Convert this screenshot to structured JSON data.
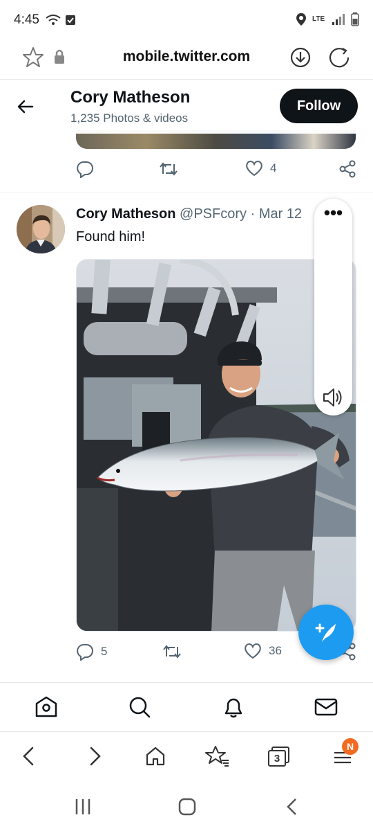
{
  "status_bar": {
    "time": "4:45",
    "network": "LTE"
  },
  "browser": {
    "url": "mobile.twitter.com",
    "tab_count": "3",
    "menu_badge": "N"
  },
  "profile_header": {
    "name": "Cory Matheson",
    "subtitle": "1,235 Photos & videos",
    "follow_label": "Follow"
  },
  "previous_tweet": {
    "like_count": "4"
  },
  "tweet": {
    "name": "Cory Matheson",
    "handle": "@PSFcory",
    "separator": "·",
    "date": "Mar 12",
    "text": "Found him!",
    "reply_count": "5",
    "like_count": "36"
  },
  "colors": {
    "twitter_blue": "#1d9bf0",
    "follow_bg": "#0f1419",
    "badge_orange": "#f36b21",
    "muted_text": "#536471"
  },
  "icons": {
    "status": [
      "wifi-icon",
      "checkbox-icon",
      "location-icon",
      "lte-icon",
      "signal-icon",
      "battery-icon"
    ],
    "browser_top": [
      "star-icon",
      "lock-icon",
      "download-icon",
      "reload-icon"
    ],
    "twitter_nav": [
      "home-icon",
      "search-icon",
      "bell-icon",
      "mail-icon"
    ],
    "browser_nav": [
      "back-icon",
      "forward-icon",
      "home-icon",
      "bookmarks-icon",
      "tabs-icon",
      "menu-icon"
    ],
    "android_nav": [
      "recents-icon",
      "home-icon",
      "back-icon"
    ]
  }
}
